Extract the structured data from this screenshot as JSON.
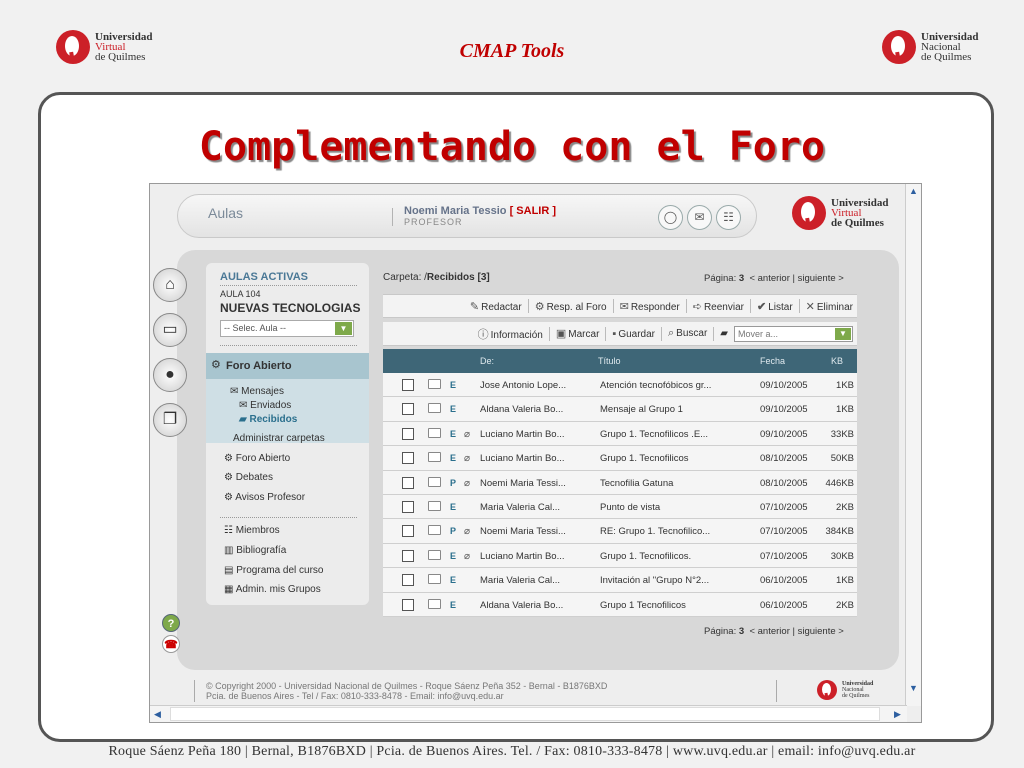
{
  "header": {
    "title": "CMAP Tools",
    "logo_left": {
      "line1": "Universidad",
      "line2": "Virtual",
      "line3": "de Quilmes"
    },
    "logo_right": {
      "line1": "Universidad",
      "line2": "Nacional",
      "line3": "de Quilmes"
    }
  },
  "slide_title": "Complementando con el Foro",
  "footer": "Roque Sáenz Peña 180 | Bernal, B1876BXD | Pcia. de Buenos Aires. Tel. / Fax: 0810-333-8478 | www.uvq.edu.ar | email: info@uvq.edu.ar",
  "app": {
    "topbar": {
      "section": "Aulas",
      "user_name": "Noemi Maria Tessio",
      "salir": "[ SALIR ]",
      "role": "PROFESOR",
      "logo": {
        "line1": "Universidad",
        "line2": "Virtual",
        "line3": "de Quilmes"
      }
    },
    "sidebar": {
      "heading": "AULAS ACTIVAS",
      "aula_num": "AULA 104",
      "aula_name": "NUEVAS TECNOLOGIAS",
      "select_placeholder": "-- Selec. Aula --",
      "foro_abierto_band": "Foro Abierto",
      "mensajes": "Mensajes",
      "enviados": "Enviados",
      "recibidos": "Recibidos",
      "admin_carpetas": "Administrar carpetas",
      "foro_abierto": "Foro Abierto",
      "debates": "Debates",
      "avisos": "Avisos Profesor",
      "miembros": "Miembros",
      "bibliografia": "Bibliografía",
      "programa": "Programa del curso",
      "admin_grupos": "Admin. mis Grupos"
    },
    "folder": {
      "label": "Carpeta: /",
      "name": "Recibidos [3]"
    },
    "pagination": {
      "label": "Página:",
      "page": "3",
      "nav": "< anterior | siguiente >"
    },
    "toolbar1": {
      "redactar": "Redactar",
      "resp_foro": "Resp. al Foro",
      "responder": "Responder",
      "reenviar": "Reenviar",
      "listar": "Listar",
      "eliminar": "Eliminar"
    },
    "toolbar2": {
      "informacion": "Información",
      "marcar": "Marcar",
      "guardar": "Guardar",
      "buscar": "Buscar",
      "mover": "Mover a..."
    },
    "table": {
      "headers": {
        "de": "De:",
        "titulo": "Título",
        "fecha": "Fecha",
        "kb": "KB"
      },
      "rows": [
        {
          "type": "E",
          "clip": false,
          "from": "Jose Antonio Lope...",
          "title": "Atención tecnofóbicos gr...",
          "date": "09/10/2005",
          "kb": "1KB"
        },
        {
          "type": "E",
          "clip": false,
          "from": "Aldana Valeria Bo...",
          "title": "Mensaje al Grupo 1",
          "date": "09/10/2005",
          "kb": "1KB"
        },
        {
          "type": "E",
          "clip": true,
          "from": "Luciano Martin Bo...",
          "title": "Grupo 1. Tecnofilicos .E...",
          "date": "09/10/2005",
          "kb": "33KB"
        },
        {
          "type": "E",
          "clip": true,
          "from": "Luciano Martin Bo...",
          "title": "Grupo 1. Tecnofilicos",
          "date": "08/10/2005",
          "kb": "50KB"
        },
        {
          "type": "P",
          "clip": true,
          "from": "Noemi Maria Tessi...",
          "title": "Tecnofilia Gatuna",
          "date": "08/10/2005",
          "kb": "446KB"
        },
        {
          "type": "E",
          "clip": false,
          "from": "Maria Valeria Cal...",
          "title": "Punto de vista",
          "date": "07/10/2005",
          "kb": "2KB"
        },
        {
          "type": "P",
          "clip": true,
          "from": "Noemi Maria Tessi...",
          "title": "RE: Grupo 1. Tecnofilico...",
          "date": "07/10/2005",
          "kb": "384KB"
        },
        {
          "type": "E",
          "clip": true,
          "from": "Luciano Martin Bo...",
          "title": "Grupo 1. Tecnofilicos.",
          "date": "07/10/2005",
          "kb": "30KB"
        },
        {
          "type": "E",
          "clip": false,
          "from": "Maria Valeria Cal...",
          "title": "Invitación al \"Grupo N°2...",
          "date": "06/10/2005",
          "kb": "1KB"
        },
        {
          "type": "E",
          "clip": false,
          "from": "Aldana Valeria Bo...",
          "title": "Grupo 1 Tecnofilicos",
          "date": "06/10/2005",
          "kb": "2KB"
        }
      ]
    },
    "copyright": {
      "line1": "© Copyright 2000 - Universidad Nacional de Quilmes - Roque Sáenz Peña 352 - Bernal - B1876BXD",
      "line2": "Pcia. de Buenos Aires - Tel / Fax: 0810-333-8478 - Email: info@uvq.edu.ar"
    },
    "footer_logo": {
      "line1": "Universidad",
      "line2": "Nacional",
      "line3": "de Quilmes"
    }
  }
}
